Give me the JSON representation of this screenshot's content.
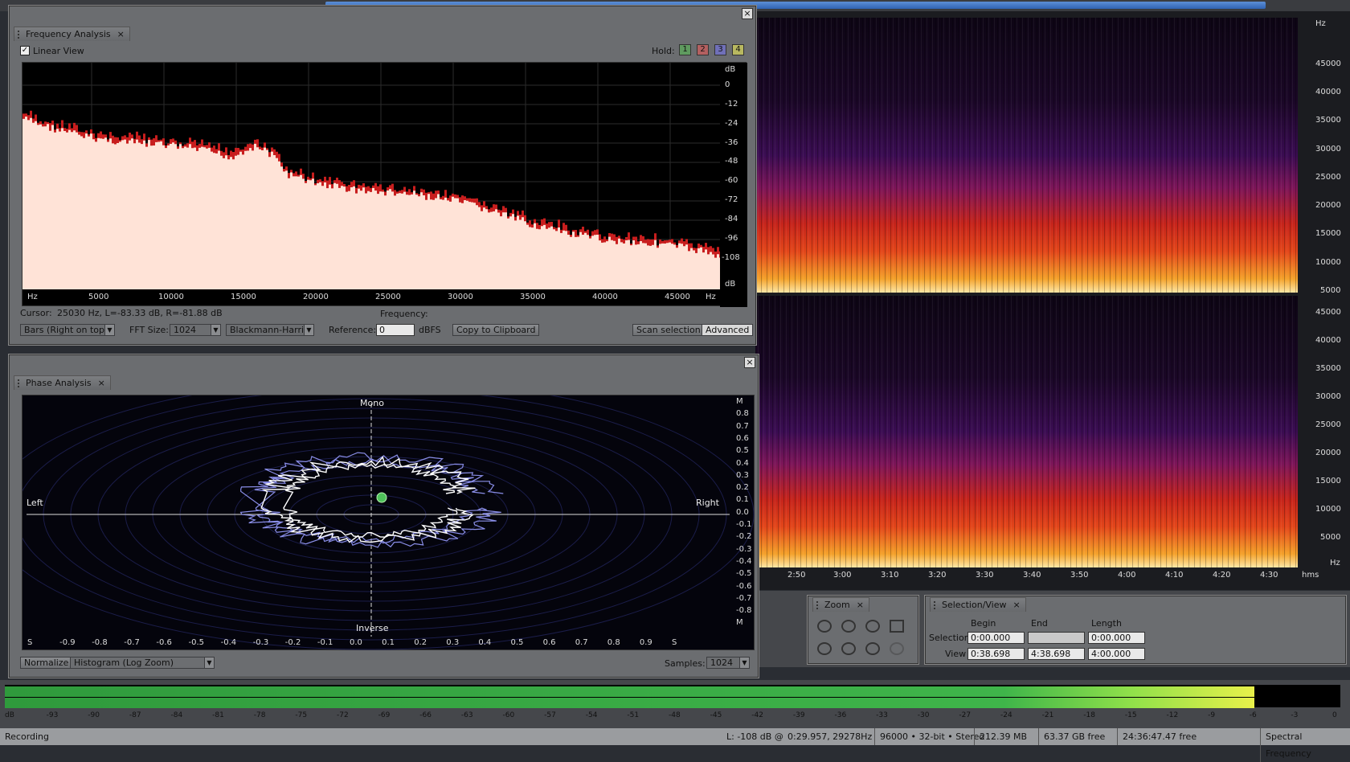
{
  "frequency_panel": {
    "tab_label": "Frequency Analysis",
    "linear_view_label": "Linear View",
    "hold_label": "Hold:",
    "hold_buttons": [
      {
        "label": "1",
        "color": "#3b7a3b"
      },
      {
        "label": "2",
        "color": "#a04040"
      },
      {
        "label": "3",
        "color": "#5050a8"
      },
      {
        "label": "4",
        "color": "#a0a040"
      }
    ],
    "y_ticks": [
      "dB",
      "0",
      "-12",
      "-24",
      "-36",
      "-48",
      "-60",
      "-72",
      "-84",
      "-96",
      "-108",
      "dB"
    ],
    "x_ticks": [
      "Hz",
      "5000",
      "10000",
      "15000",
      "20000",
      "25000",
      "30000",
      "35000",
      "40000",
      "45000",
      "Hz"
    ],
    "cursor_label": "Cursor:",
    "cursor_value": "25030 Hz, L=-83.33 dB, R=-81.88 dB",
    "frequency_label": "Frequency:",
    "display_mode": "Bars (Right on top)",
    "fft_size_label": "FFT Size:",
    "fft_size": "1024",
    "window": "Blackmann-Harris",
    "reference_label": "Reference:",
    "reference_value": "0",
    "reference_unit": "dBFS",
    "copy_button": "Copy to Clipboard",
    "scan_button": "Scan selection",
    "advanced_button": "Advanced",
    "colors": {
      "fill": "#ffe3d7",
      "peak": "#c81e1e"
    }
  },
  "phase_panel": {
    "tab_label": "Phase Analysis",
    "mono_label": "Mono",
    "inverse_label": "Inverse",
    "left_label": "Left",
    "right_label": "Right",
    "y_ticks": [
      "M",
      "0.8",
      "0.7",
      "0.6",
      "0.5",
      "0.4",
      "0.3",
      "0.2",
      "0.1",
      "0.0",
      "-0.1",
      "-0.2",
      "-0.3",
      "-0.4",
      "-0.5",
      "-0.6",
      "-0.7",
      "-0.8",
      "M"
    ],
    "x_ticks": [
      "S",
      "-0.9",
      "-0.8",
      "-0.7",
      "-0.6",
      "-0.5",
      "-0.4",
      "-0.3",
      "-0.2",
      "-0.1",
      "0.0",
      "0.1",
      "0.2",
      "0.3",
      "0.4",
      "0.5",
      "0.6",
      "0.7",
      "0.8",
      "0.9",
      "S"
    ],
    "normalize_button": "Normalize",
    "mode": "Histogram (Log Zoom)",
    "samples_label": "Samples:",
    "samples_value": "1024"
  },
  "spectrogram": {
    "top_hz_ticks": [
      "Hz",
      "45000",
      "40000",
      "35000",
      "30000",
      "25000",
      "20000",
      "15000",
      "10000",
      "5000"
    ],
    "bottom_hz_ticks": [
      "45000",
      "40000",
      "35000",
      "30000",
      "25000",
      "20000",
      "15000",
      "10000",
      "5000",
      "Hz"
    ],
    "time_ticks": [
      "2:50",
      "3:00",
      "3:10",
      "3:20",
      "3:30",
      "3:40",
      "3:50",
      "4:00",
      "4:10",
      "4:20",
      "4:30",
      "hms"
    ]
  },
  "zoom_panel": {
    "tab_label": "Zoom"
  },
  "selection_panel": {
    "tab_label": "Selection/View",
    "col_begin": "Begin",
    "col_end": "End",
    "col_length": "Length",
    "row_selection": "Selection",
    "row_view": "View",
    "selection_begin": "0:00.000",
    "selection_end": "",
    "selection_length": "0:00.000",
    "view_begin": "0:38.698",
    "view_end": "4:38.698",
    "view_length": "4:00.000"
  },
  "meter": {
    "ticks": [
      "dB",
      "-93",
      "-90",
      "-87",
      "-84",
      "-81",
      "-78",
      "-75",
      "-72",
      "-69",
      "-66",
      "-63",
      "-60",
      "-57",
      "-54",
      "-51",
      "-48",
      "-45",
      "-42",
      "-39",
      "-36",
      "-33",
      "-30",
      "-27",
      "-24",
      "-21",
      "-18",
      "-15",
      "-12",
      "-9",
      "-6",
      "-3",
      "0"
    ],
    "left_level_db": -6.2,
    "right_level_db": -6.2
  },
  "status_bar": {
    "state": "Recording",
    "level": "L: -108 dB @",
    "position": "0:29.957, 29278Hz",
    "format": "96000 • 32-bit • Stereo",
    "size": "212.39 MB",
    "disk_free": "63.37 GB free",
    "time_free": "24:36:47.47 free",
    "view_mode": "Spectral Frequency"
  }
}
